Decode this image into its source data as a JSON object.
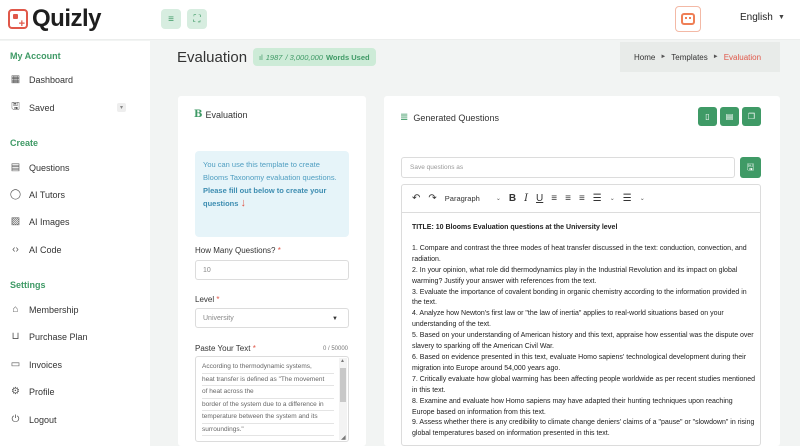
{
  "app": {
    "name": "Quizly"
  },
  "header": {
    "language": "English"
  },
  "sidebar": {
    "sections": [
      {
        "title": "My Account",
        "items": [
          {
            "label": "Dashboard"
          },
          {
            "label": "Saved"
          }
        ]
      },
      {
        "title": "Create",
        "items": [
          {
            "label": "Questions"
          },
          {
            "label": "AI Tutors"
          },
          {
            "label": "AI Images"
          },
          {
            "label": "AI Code"
          }
        ]
      },
      {
        "title": "Settings",
        "items": [
          {
            "label": "Membership"
          },
          {
            "label": "Purchase Plan"
          },
          {
            "label": "Invoices"
          },
          {
            "label": "Profile"
          },
          {
            "label": "Logout"
          }
        ]
      }
    ]
  },
  "page": {
    "title": "Evaluation",
    "words_used": {
      "count": "1987",
      "limit": "/ 3,000,000",
      "label": "Words Used"
    },
    "breadcrumb": [
      "Home",
      "Templates",
      "Evaluation"
    ]
  },
  "form": {
    "title": "Evaluation",
    "info": {
      "text": "You can use this template to create Blooms Taxonomy evaluation questions.",
      "bold": "Please fill out below to create your questions",
      "arrow": "↓"
    },
    "num_questions": {
      "label": "How Many Questions?",
      "value": "10"
    },
    "level": {
      "label": "Level",
      "value": "University"
    },
    "paste_text": {
      "label": "Paste Your Text",
      "counter": "0 / 50000",
      "lines": [
        "According to thermodynamic systems,",
        "heat transfer is defined as \"The movement",
        "of heat across the",
        "border of the system due to a difference in",
        "temperature between the system and its",
        "surroundings.\""
      ]
    },
    "required_mark": "*"
  },
  "output": {
    "title": "Generated Questions",
    "save_placeholder": "Save questions as",
    "toolbar": {
      "paragraph": "Paragraph"
    },
    "content_title": "TITLE: 10 Blooms Evaluation questions at the University level",
    "questions": [
      "1. Compare and contrast the three modes of heat transfer discussed in the text: conduction, convection, and radiation.",
      "2. In your opinion, what role did thermodynamics play in the Industrial Revolution and its impact on global warming? Justify your answer with references from the text.",
      "3. Evaluate the importance of covalent bonding in organic chemistry according to the information provided in the text.",
      "4. Analyze how Newton's first law or \"the law of inertia\" applies to real-world situations based on your understanding of the text.",
      "5. Based on your understanding of American history and this text, appraise how essential was the dispute over slavery to sparking off the American Civil War.",
      "6. Based on evidence presented in this text, evaluate Homo sapiens' technological development during their migration into Europe around 54,000 years ago.",
      "7. Critically evaluate how global warming has been affecting people worldwide as per recent studies mentioned in this text.",
      "8. Examine and evaluate how Homo sapiens may have adapted their hunting techniques upon reaching Europe based on information from this text.",
      "9. Assess whether there is any credibility to climate change deniers' claims of a \"pause\" or \"slowdown\" in rising global temperatures based on information presented in this text."
    ]
  },
  "colors": {
    "accent": "#3f9a66",
    "brand": "#e0584a",
    "info_bg": "#e6f4f9"
  }
}
